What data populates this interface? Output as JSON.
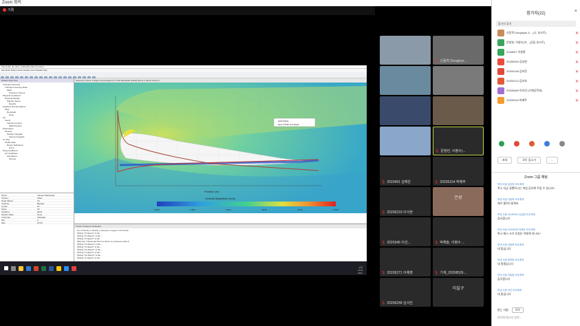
{
  "window": {
    "title": "Zoom 회의"
  },
  "share": {
    "label": "기록"
  },
  "fluent": {
    "title": "Fluent  [2d, dp, pbns, sstkw] [Double Precision]",
    "menu": "File   Mesh   Define   Solve   Results   View   Parallel   Help",
    "tree_tabs": "Outline View   Tree",
    "tree": [
      "Turbulent Viscosity",
      "Turbulent Viscosity Ratio",
      "Mesh",
      "Pressure Contour",
      "Physical Conditions",
      "Physical Models",
      "Solution Setup",
      "Results",
      "Graphics and Animations",
      "Plots",
      "Residuals",
      "Drag",
      "Lift",
      "Vector",
      "Velocity Contour",
      "Wall Pressure",
      "Parameters",
      "Reports",
      "Surface Integrals",
      "Volume Integrals",
      "XY Plot",
      "Profile Data",
      "Report Definitions",
      "Force",
      "Drag Coefficient",
      "Lift Coefficient",
      "Animations",
      "Scenes"
    ],
    "props": [
      [
        "Name",
        "Velocity Magnitude"
      ],
      [
        "Options",
        "Filled"
      ],
      [
        "Node Values",
        "On"
      ],
      [
        "Coloring",
        "Banded"
      ],
      [
        "Levels",
        "20"
      ],
      [
        "Setup",
        "All"
      ],
      [
        "Surfaces",
        "airfoil"
      ],
      [
        "Display State",
        "None"
      ],
      [
        "Colormap",
        "Standard"
      ],
      [
        "Min",
        "0"
      ],
      [
        "Max",
        "23.63"
      ]
    ],
    "graphics_tabs": "Geometry Scene 1   Drag-cl-Convergence   XY Plot   Residuals   Scaled Scene 1   Vector Scene 1",
    "legend_items": [
      "Airfoil-Wing",
      "New XYPlot Line Equiv"
    ],
    "colorbar_title": "Velocity Magnitude (m/s)",
    "colorbar_ticks": [
      "0.000",
      "5.000",
      "10.00",
      "15.00",
      "20.00",
      "23.63"
    ],
    "axis_x": "Position (m)",
    "output_tabs": "Output   Cl Report   Cd Report",
    "output_lines": [
      "  iter   continuity   x-velocity   y-velocity   k   omega   cl   cd   time/iter",
      "  Writing \"Cl Report\" to file ...",
      "  Writing \"Cd Report\" to file ...",
      "  Writing \"Cl Report\" to file ...",
      "  Warning: 1 Reversed flow in 2 faces on pressure-outlet 3.",
      "  Writing \"Cd Report\" to file ...",
      "  Writing \"Cl Report\" to file ...",
      "  Writing \"Cd Report\" to file ...",
      "  Writing \"Cl Report\" to file ...",
      "  Writing \"Cd Report\" to file ...",
      "  Writing \"Cl Report\" to file ..."
    ],
    "clock": [
      "오후 11:24",
      "2022-12-01"
    ]
  },
  "gallery": [
    {
      "label": "",
      "big": ""
    },
    {
      "label": "신동혁 Donghye...",
      "big": ""
    },
    {
      "label": "",
      "big": ""
    },
    {
      "label": "",
      "big": ""
    },
    {
      "label": "",
      "big": ""
    },
    {
      "label": "",
      "big": ""
    },
    {
      "label": "",
      "big": ""
    },
    {
      "label": "문창헌, 이병수(...",
      "big": ""
    },
    {
      "label": "2020491 김예은",
      "big": ""
    },
    {
      "label": "20205154 박혜주",
      "big": ""
    },
    {
      "label": "20206233 이서현",
      "big": ""
    },
    {
      "label": "",
      "big": "은성"
    },
    {
      "label": "2020346 이선...",
      "big": ""
    },
    {
      "label": "박해솔, 이병수 ...",
      "big": ""
    },
    {
      "label": "20205271 이채영",
      "big": ""
    },
    {
      "label": "기계_20208526...",
      "big": ""
    },
    {
      "label": "20206248 김서진",
      "big": ""
    },
    {
      "label": "",
      "big": "이길구"
    }
  ],
  "panel": {
    "title": "참가자(22)",
    "invite": "참가자 찾기",
    "participants": [
      {
        "name": "신동혁 Donghyuk S... (나, 호스트)",
        "color": "#c98a5c"
      },
      {
        "name": "문창헌, 이병수(이... (공동 호스트)",
        "color": "#3ba55c"
      },
      {
        "name": "2018007 이춘환",
        "color": "#37a65b"
      },
      {
        "name": "20180040 김성현",
        "color": "#e74c3c"
      },
      {
        "name": "20200148 김보준",
        "color": "#e04a3a"
      },
      {
        "name": "20202214 김지호",
        "color": "#e05a3a"
      },
      {
        "name": "20205489 이유민 (기계공학과)",
        "color": "#a56fcf"
      },
      {
        "name": "20205154 박혜주",
        "color": "#f39c32"
      }
    ],
    "dot_colors": [
      "#2e9e56",
      "#e04a3a",
      "#e05a3a",
      "#3b7ddd",
      "#888888"
    ],
    "buttons": [
      "초대",
      "모두 음소거",
      "..."
    ],
    "chat_title": "Zoom 그룹 채팅",
    "messages": [
      {
        "from": "보낸 사람 김성현 모두에게",
        "text": "혹시 지금 실행하시는 파일 공유해 주실 수 있나요?"
      },
      {
        "from": "보낸 사람 신동혁 모두에게",
        "text": "제가 올려드릴게요"
      },
      {
        "from": "보낸 사람 20180040 김성현 모두에게",
        "text": "감사합니다"
      },
      {
        "from": "보낸 사람 20205154 박혜주 모두에게",
        "text": "혹시 메시 크기 조정은 어떻게 하나요?"
      },
      {
        "from": "보낸 사람 신동혁 모두에게",
        "text": "네 맞습니다"
      },
      {
        "from": "보낸 사람 문창헌 모두에게",
        "text": "네 알겠습니다"
      },
      {
        "from": "보낸 사람 이춘환 모두에게",
        "text": "감사합니다"
      },
      {
        "from": "보낸 사람 이선 모두에게",
        "text": "네 맞습니다"
      }
    ],
    "recipient_label": "받는 사람:",
    "recipient": "모두",
    "input_placeholder": "여기에 메시지 입력..."
  }
}
